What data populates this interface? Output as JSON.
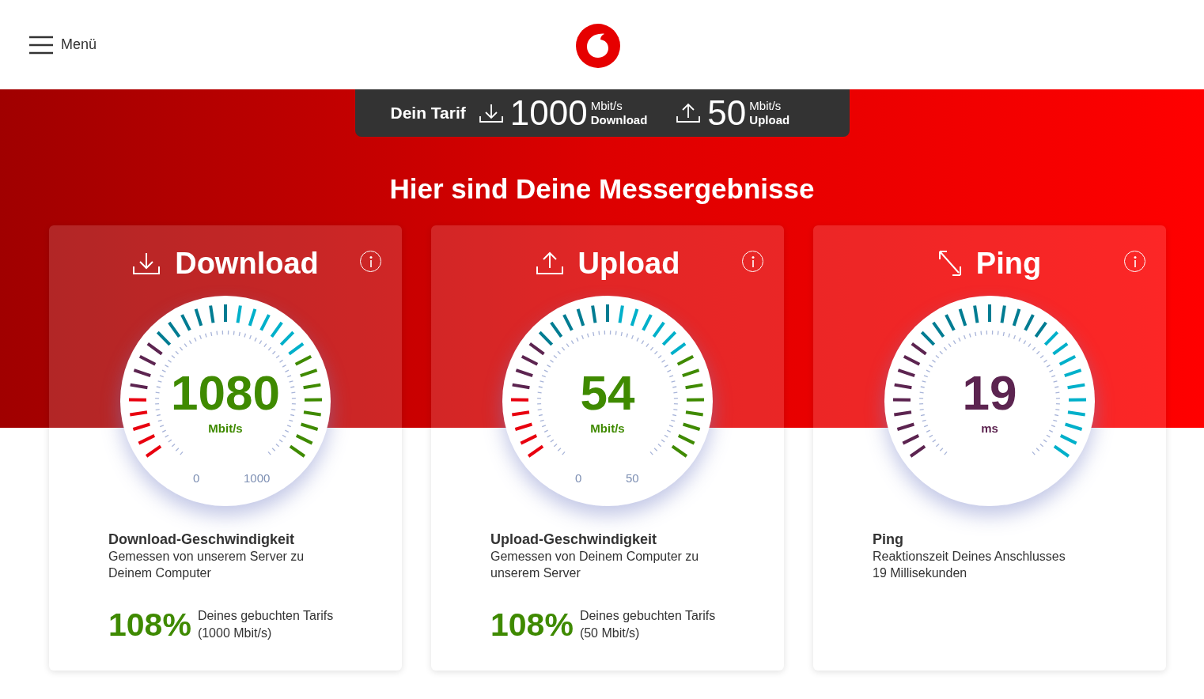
{
  "header": {
    "menu_label": "Menü"
  },
  "tariff": {
    "label": "Dein Tarif",
    "download_value": "1000",
    "download_unit": "Mbit/s",
    "download_label": "Download",
    "upload_value": "50",
    "upload_unit": "Mbit/s",
    "upload_label": "Upload"
  },
  "headline": "Hier sind Deine Messergebnisse",
  "cards": [
    {
      "kind": "download",
      "title": "Download",
      "value": "1080",
      "unit": "Mbit/s",
      "color": "#3f8a00",
      "scale_min": "0",
      "scale_max": "1000",
      "heading": "Download-Geschwindigkeit",
      "description_lines": [
        "Gemessen von unserem Server zu",
        "Deinem Computer"
      ],
      "percent": "108%",
      "tariff_note": "Deines gebuchten Tarifs",
      "tariff_value": "(1000 Mbit/s)"
    },
    {
      "kind": "upload",
      "title": "Upload",
      "value": "54",
      "unit": "Mbit/s",
      "color": "#3f8a00",
      "scale_min": "0",
      "scale_max": "50",
      "heading": "Upload-Geschwindigkeit",
      "description_lines": [
        "Gemessen von Deinem Computer zu",
        "unserem Server"
      ],
      "percent": "108%",
      "tariff_note": "Deines gebuchten Tarifs",
      "tariff_value": "(50 Mbit/s)"
    },
    {
      "kind": "ping",
      "title": "Ping",
      "value": "19",
      "unit": "ms",
      "color": "#5c2450",
      "heading": "Ping",
      "description_lines": [
        "Reaktionszeit Deines Anschlusses",
        "19 Millisekunden"
      ]
    }
  ]
}
